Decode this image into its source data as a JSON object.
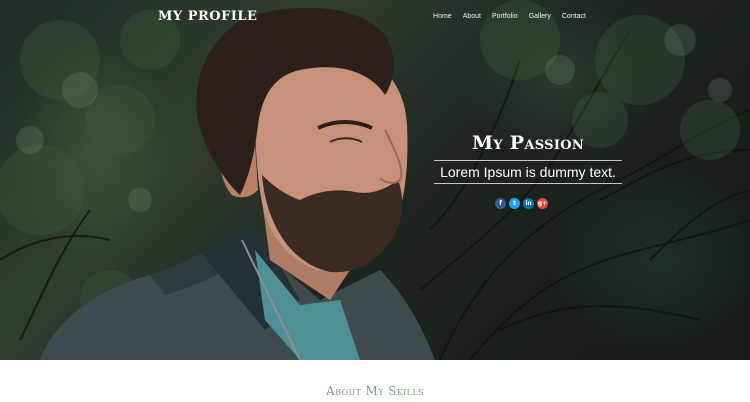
{
  "header": {
    "logo": "MY PROFILE",
    "nav": [
      "Home",
      "About",
      "Portfolio",
      "Gallery",
      "Contact"
    ]
  },
  "hero": {
    "title": "My Passion",
    "subtitle": "Lorem Ipsum is dummy text.",
    "social": [
      {
        "icon": "facebook-icon",
        "glyph": "f",
        "color": "#3b5998"
      },
      {
        "icon": "twitter-icon",
        "glyph": "t",
        "color": "#1da1f2"
      },
      {
        "icon": "linkedin-icon",
        "glyph": "in",
        "color": "#0077b5"
      },
      {
        "icon": "google-plus-icon",
        "glyph": "g+",
        "color": "#dd4b39"
      }
    ]
  },
  "section": {
    "title": "About My Skills"
  },
  "colors": {
    "accent": "#7ea27c"
  }
}
